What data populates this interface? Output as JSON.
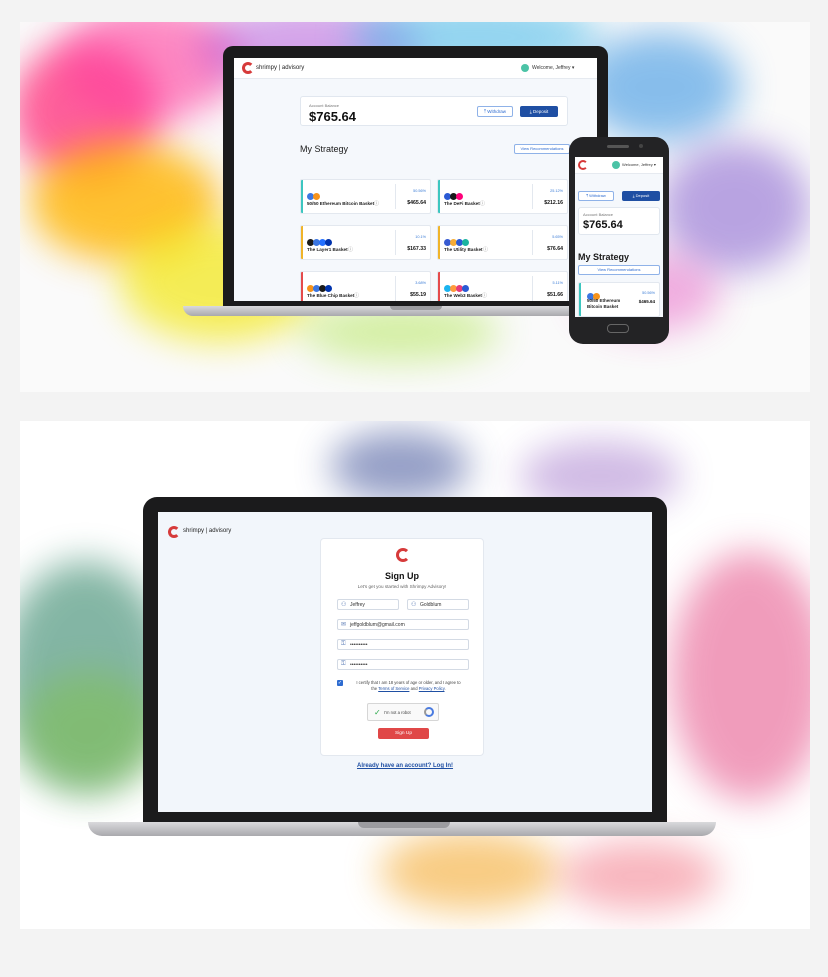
{
  "dashboard": {
    "brand": "shrimpy | advisory",
    "welcome": "Welcome, Jeffrey",
    "balance_label": "Account Balance",
    "balance": "$765.64",
    "withdraw": "Withdraw",
    "deposit": "Deposit",
    "strategy_title": "My Strategy",
    "view_recommendations": "View Recommendations",
    "baskets": [
      {
        "name": "50/50 Ethereum Bitcoin Basket",
        "pct": "50.56%",
        "amount": "$465.64",
        "color": "#3cc6c0",
        "coins": [
          "#3b76e1",
          "#f7931a"
        ]
      },
      {
        "name": "The DeFi Basket",
        "pct": "25.12%",
        "amount": "$212.16",
        "color": "#3cc6c0",
        "coins": [
          "#2a5ad4",
          "#1a1a1a",
          "#ff007a"
        ]
      },
      {
        "name": "The Layer1 Basket",
        "pct": "10.1%",
        "amount": "$167.33",
        "color": "#f0b429",
        "coins": [
          "#1a1a1a",
          "#3b76e1",
          "#2470ff",
          "#0033ad"
        ]
      },
      {
        "name": "The Utility Basket",
        "pct": "5.65%",
        "amount": "$76.64",
        "color": "#f0b429",
        "coins": [
          "#375bd2",
          "#f5ac37",
          "#2a5ad4",
          "#1ab4a0"
        ]
      },
      {
        "name": "The Blue Chip Basket",
        "pct": "3.68%",
        "amount": "$55.19",
        "color": "#e54b4b",
        "coins": [
          "#f7931a",
          "#3b76e1",
          "#1a1a1a",
          "#0033ad"
        ]
      },
      {
        "name": "The Web3 Basket",
        "pct": "5.11%",
        "amount": "$51.66",
        "color": "#e54b4b",
        "coins": [
          "#1ab4f0",
          "#ff9a3c",
          "#e63b7a",
          "#2a5ad4"
        ]
      }
    ]
  },
  "phone": {
    "welcome": "Welcome, Jeffrey",
    "withdraw": "Withdraw",
    "deposit": "Deposit",
    "balance_label": "Account Balance",
    "balance": "$765.64",
    "strategy_title": "My Strategy",
    "view_recommendations": "View Recommendations",
    "basket_name_1": "50/50 Ethereum",
    "basket_name_2": "Bitcoin Basket",
    "pct": "50.56%",
    "amount": "$465.64"
  },
  "signup": {
    "brand": "shrimpy | advisory",
    "title": "Sign Up",
    "subtitle": "Let's get you started with Shrimpy Advisory!",
    "first_name": "Jeffrey",
    "last_name": "Goldblum",
    "email": "jeffgoldblum@gmail.com",
    "password": "••••••••••",
    "confirm_password": "••••••••••",
    "certify_1": "I certify that I am 18 years of age or older, and I agree to",
    "certify_2a": "the",
    "terms": "Terms of Service",
    "certify_2b": "and",
    "privacy": "Privacy Policy",
    "captcha": "I'm not a robot",
    "submit": "Sign Up",
    "login_link": "Already have an account? Log In!"
  },
  "colors": {
    "accent": "#1f4fa3",
    "brand_red": "#d63a3a",
    "link": "#2d6bd0"
  }
}
